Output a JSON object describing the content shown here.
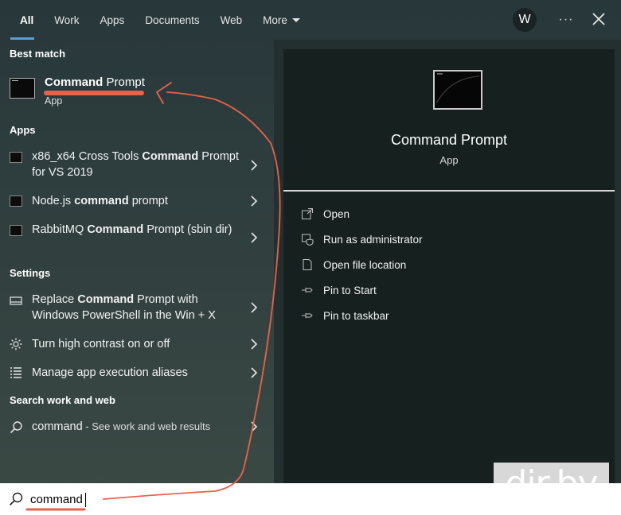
{
  "tabs": [
    {
      "label": "All",
      "active": true
    },
    {
      "label": "Work"
    },
    {
      "label": "Apps"
    },
    {
      "label": "Documents"
    },
    {
      "label": "Web"
    },
    {
      "label": "More"
    }
  ],
  "header": {
    "avatar_letter": "W",
    "more_icon": "more-dots-icon",
    "close_icon": "close-icon"
  },
  "sections": {
    "best_match": "Best match",
    "apps": "Apps",
    "settings": "Settings",
    "search_web": "Search work and web"
  },
  "best_match": {
    "title_bold": "Command",
    "title_rest": " Prompt",
    "subtitle": "App"
  },
  "apps": [
    {
      "pre": "x86_x64 Cross Tools ",
      "bold": "Command",
      "post": " Prompt for VS 2019"
    },
    {
      "pre": "Node.js ",
      "bold": "command",
      "post": " prompt"
    },
    {
      "pre": "RabbitMQ ",
      "bold": "Command",
      "post": " Prompt (sbin dir)"
    }
  ],
  "settings": [
    {
      "pre": "Replace ",
      "bold": "Command",
      "post": " Prompt with Windows PowerShell in the Win + X",
      "icon": "taskbar-icon"
    },
    {
      "pre": "Turn high contrast on or off",
      "bold": "",
      "post": "",
      "icon": "sun-icon"
    },
    {
      "pre": "Manage app execution aliases",
      "bold": "",
      "post": "",
      "icon": "list-icon"
    }
  ],
  "web": {
    "query": "command",
    "hint": " - See work and web results"
  },
  "preview": {
    "title": "Command Prompt",
    "subtitle": "App",
    "actions": [
      {
        "label": "Open",
        "icon": "open-icon"
      },
      {
        "label": "Run as administrator",
        "icon": "shield-icon"
      },
      {
        "label": "Open file location",
        "icon": "file-icon"
      },
      {
        "label": "Pin to Start",
        "icon": "pin-icon"
      },
      {
        "label": "Pin to taskbar",
        "icon": "pin-icon"
      }
    ]
  },
  "search": {
    "value": "command"
  },
  "watermark": "dir.by",
  "colors": {
    "accent": "#5a9fd6",
    "annotation": "#e8624a"
  }
}
